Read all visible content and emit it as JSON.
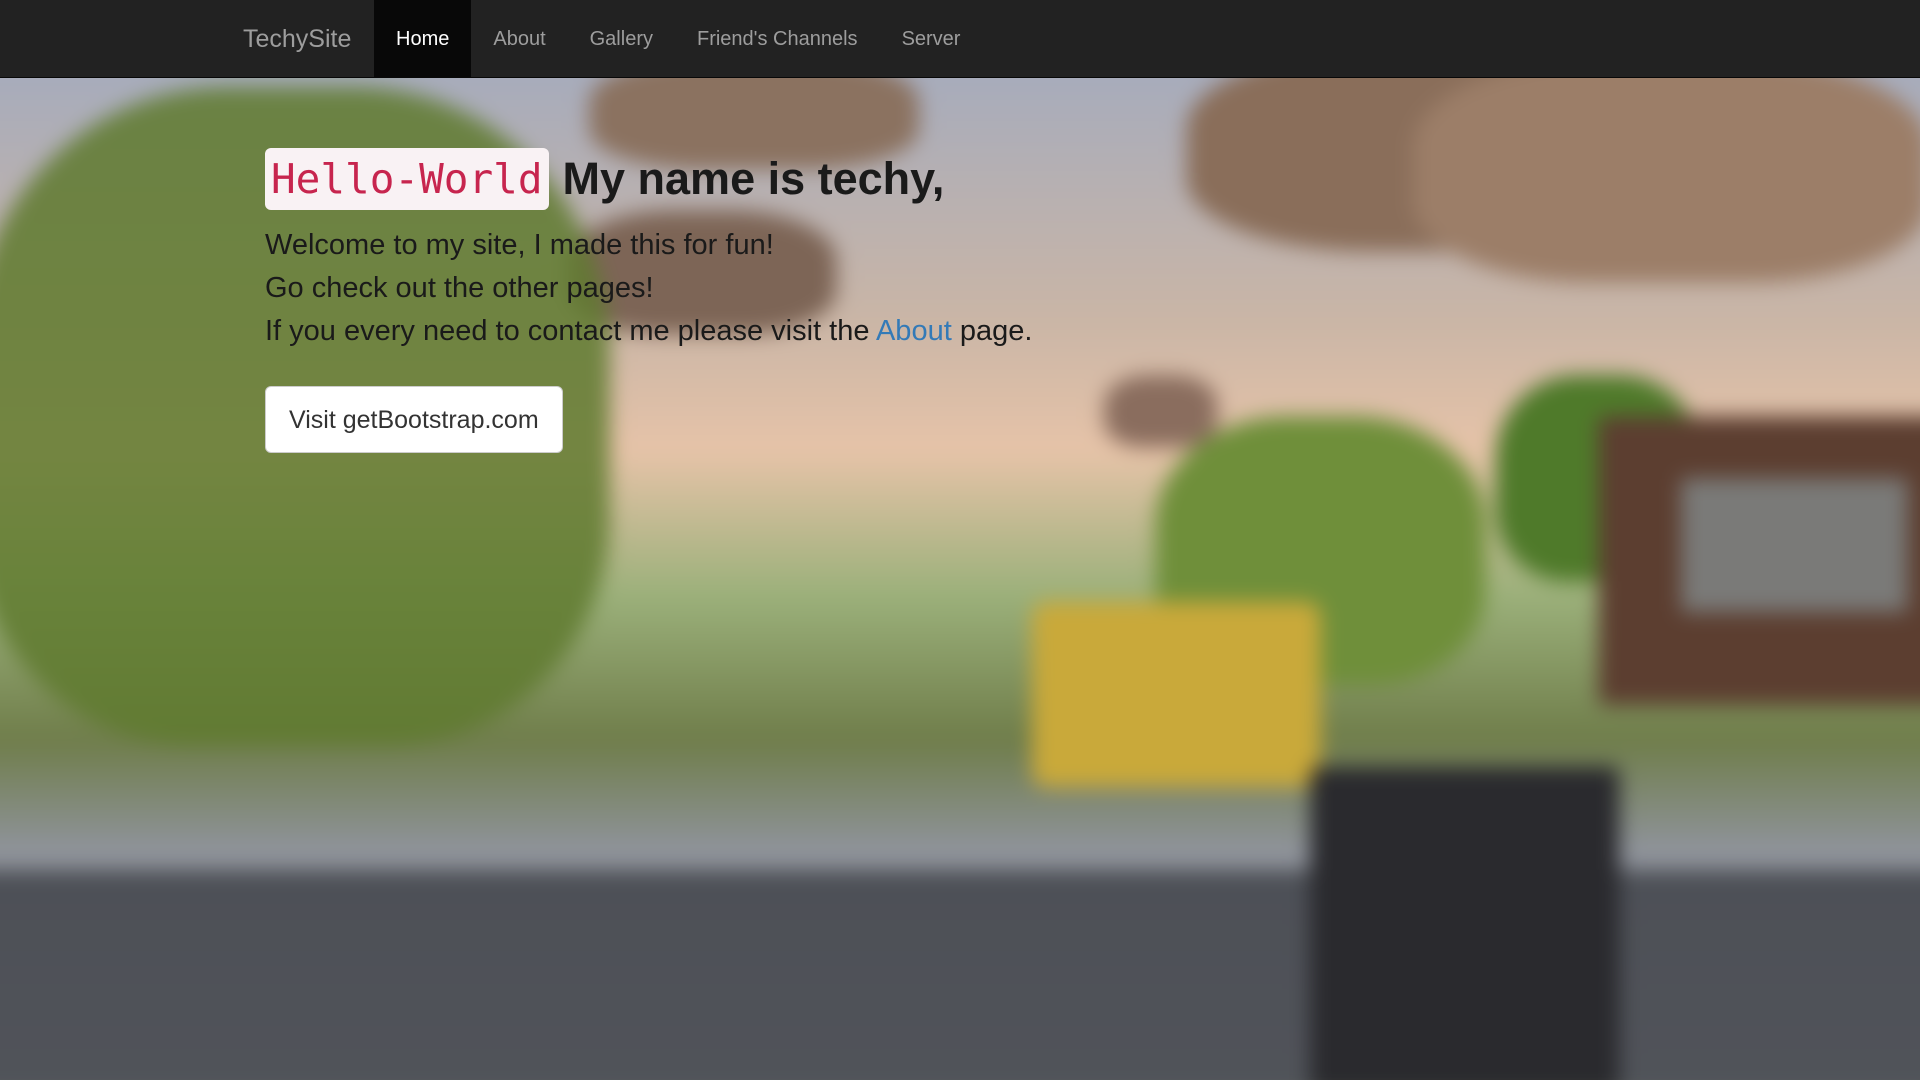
{
  "navbar": {
    "brand": "TechySite",
    "items": [
      {
        "label": "Home",
        "active": true
      },
      {
        "label": "About",
        "active": false
      },
      {
        "label": "Gallery",
        "active": false
      },
      {
        "label": "Friend's Channels",
        "active": false
      },
      {
        "label": "Server",
        "active": false
      }
    ]
  },
  "hero": {
    "code_badge": "Hello-World",
    "heading": "My name is techy,",
    "line1": "Welcome to my site, I made this for fun!",
    "line2": "Go check out the other pages!",
    "line3_before": "If you every need to contact me please visit the ",
    "line3_link": "About",
    "line3_after": " page.",
    "button_label": "Visit getBootstrap.com"
  },
  "colors": {
    "navbar_bg": "#222222",
    "active_bg": "#080808",
    "link": "#337ab7",
    "code_text": "#c7254e",
    "code_bg": "#f9f2f4"
  }
}
